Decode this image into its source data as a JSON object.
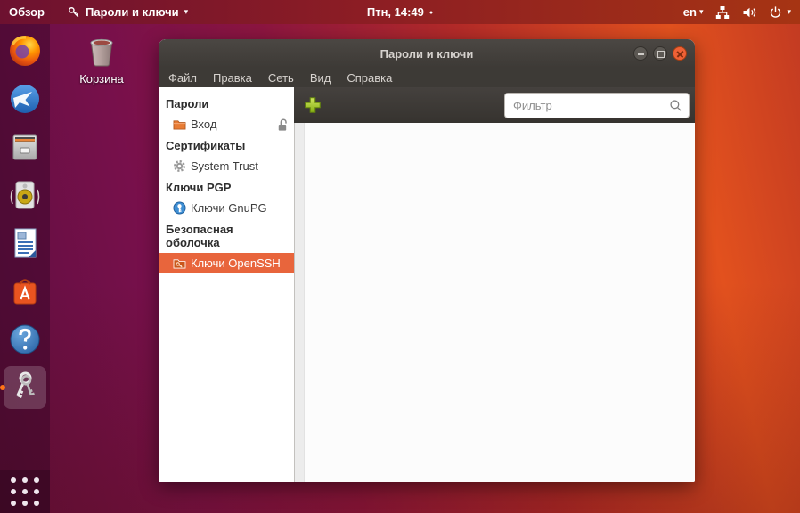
{
  "topbar": {
    "activities_label": "Обзор",
    "app_menu_label": "Пароли и ключи",
    "clock": "Птн, 14:49",
    "notification_dot": "●",
    "keyboard_layout": "en",
    "caret": "▾"
  },
  "desktop": {
    "trash_label": "Корзина"
  },
  "dock": {
    "items": [
      "firefox",
      "thunderbird",
      "files",
      "rhythmbox",
      "libreoffice-writer",
      "ubuntu-software",
      "help",
      "seahorse-passwords-keys",
      "show-applications"
    ],
    "active_item": "seahorse-passwords-keys"
  },
  "window": {
    "title": "Пароли и ключи",
    "menubar": [
      {
        "label": "Файл"
      },
      {
        "label": "Правка"
      },
      {
        "label": "Сеть"
      },
      {
        "label": "Вид"
      },
      {
        "label": "Справка"
      }
    ],
    "toolbar": {
      "filter_placeholder": "Фильтр",
      "filter_value": ""
    },
    "sidebar": {
      "sections": [
        {
          "header": "Пароли",
          "items": [
            {
              "label": "Вход",
              "icon": "folder-login",
              "trailing_icon": "unlock"
            }
          ]
        },
        {
          "header": "Сертификаты",
          "items": [
            {
              "label": "System Trust",
              "icon": "gear"
            }
          ]
        },
        {
          "header": "Ключи PGP",
          "items": [
            {
              "label": "Ключи GnuPG",
              "icon": "gnupg-key"
            }
          ]
        },
        {
          "header": "Безопасная оболочка",
          "items": [
            {
              "label": "Ключи OpenSSH",
              "icon": "openssh-key",
              "selected": true
            }
          ]
        }
      ]
    },
    "content": {
      "empty": true
    }
  },
  "colors": {
    "accent_orange": "#E95420",
    "selection_orange": "#e8653c",
    "plus_green": "#9ec323",
    "titlebar_gray": "#3d3a36",
    "topbar_left": "#6d1130",
    "topbar_right": "#a63413"
  }
}
